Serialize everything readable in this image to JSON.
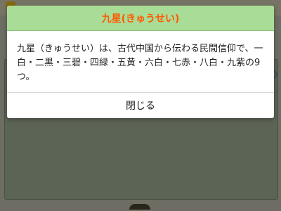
{
  "dialog": {
    "title": "九星(きゅうせい)",
    "message": "九星（きゅうせい）は、古代中国から伝わる民間信仰で、一白・二黒・三碧・四緑・五黄・六白・七赤・八白・九紫の9つ。",
    "close_label": "閉じる"
  },
  "colors": {
    "header_bg": "#a9dc97",
    "title_text": "#ff5a00"
  }
}
